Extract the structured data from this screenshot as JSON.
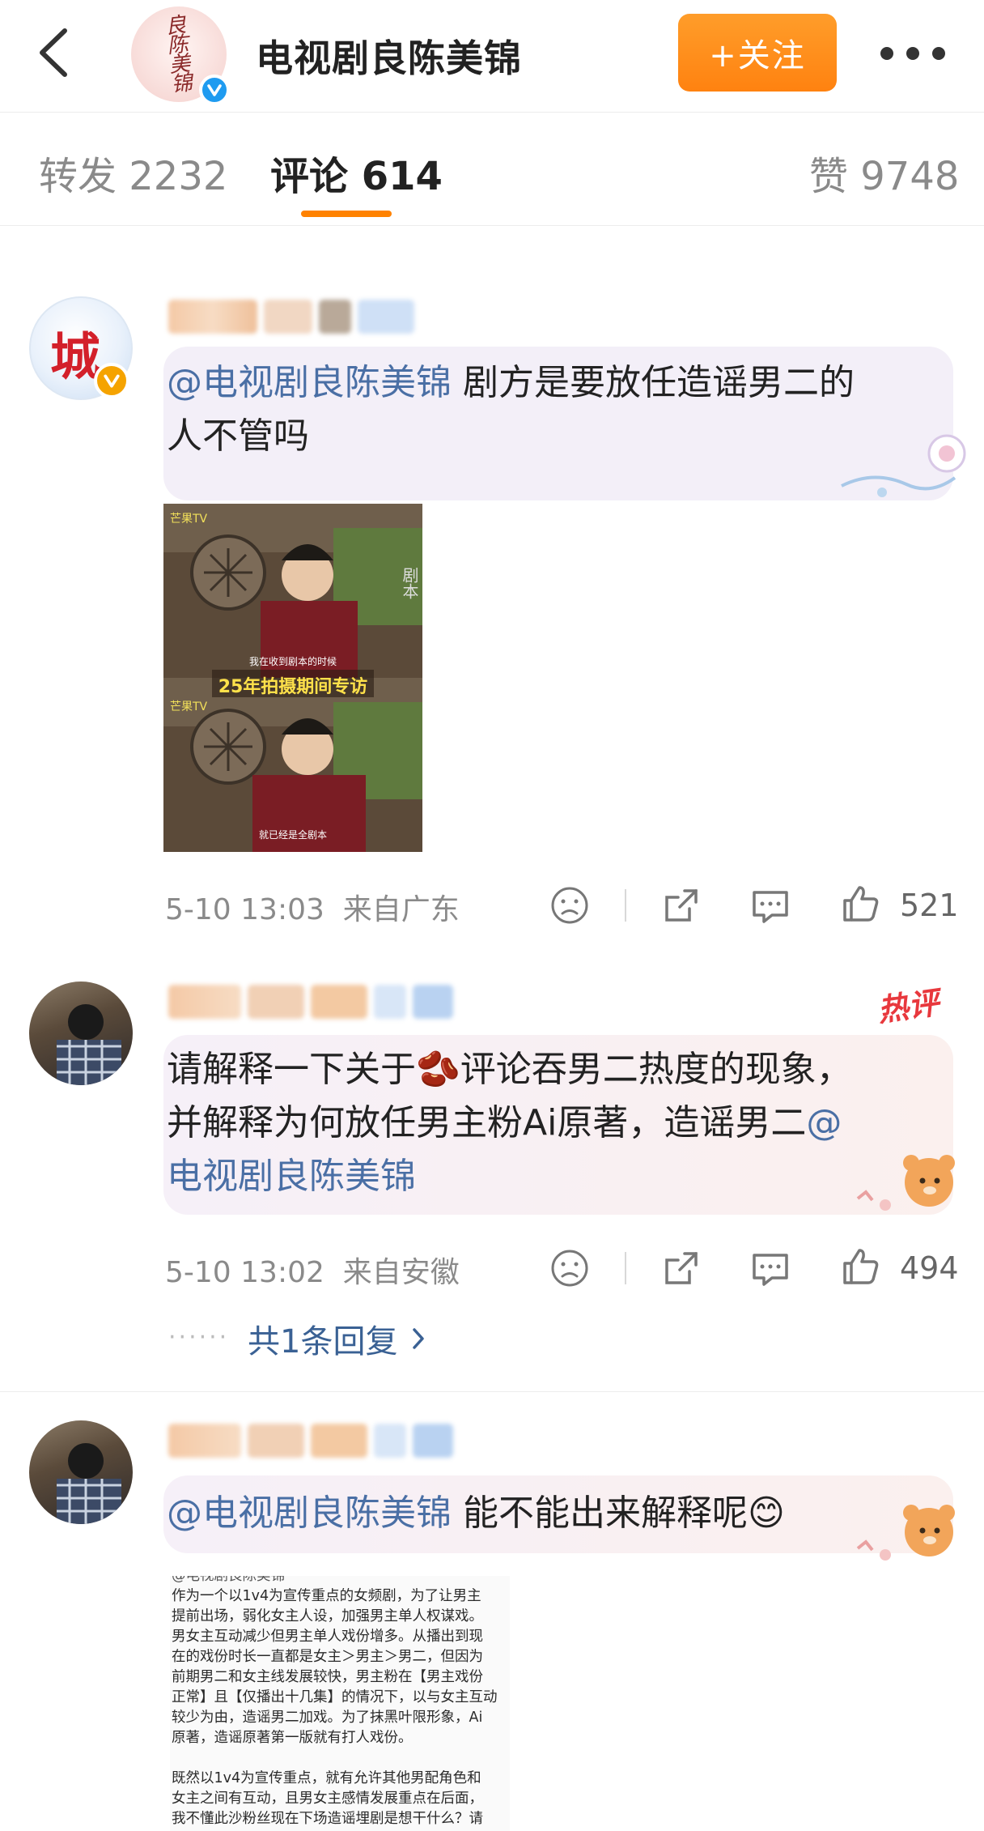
{
  "header": {
    "account_name": "电视剧良陈美锦",
    "avatar_glyphs": "良陈美锦",
    "follow_label": "+关注"
  },
  "tabs": [
    {
      "label": "转发 2232",
      "active": false
    },
    {
      "label": "评论 614",
      "active": true
    },
    {
      "label": "赞 9748",
      "active": false
    }
  ],
  "comments": [
    {
      "avatar_char": "城",
      "mention": "@电视剧良陈美锦",
      "text_line1": "剧方是要放任造谣男二的",
      "text_line2": "人不管吗",
      "video": {
        "watermark_top": "芒果TV",
        "caption_top": "我在收到剧本的时候",
        "banner": "25年拍摄期间专访",
        "side_text": "剧本",
        "watermark_bottom": "芒果TV",
        "caption_bottom": "就已经是全剧本"
      },
      "time": "5-10 13:03",
      "location": "来自广东",
      "likes": "521"
    },
    {
      "hot_tag": "热评",
      "text_line1": "请解释一下关于🫘评论吞男二热度的现象，",
      "text_line2_a": "并解释为何放任男主粉Ai原著，造谣男二",
      "text_line2_b": "@",
      "text_line3": "电视剧良陈美锦",
      "time": "5-10 13:02",
      "location": "来自安徽",
      "likes": "494",
      "replies_label": "共1条回复"
    },
    {
      "mention": "@电视剧良陈美锦",
      "text": "能不能出来解释呢😊",
      "doc_lines": [
        "@电视剧良陈美锦",
        "作为一个以1v4为宣传重点的女频剧，为了让男主",
        "提前出场，弱化女主人设，加强男主单人权谋戏。",
        "男女主互动减少但男主单人戏份增多。从播出到现",
        "在的戏份时长一直都是女主＞男主＞男二，但因为",
        "前期男二和女主线发展较快，男主粉在【男主戏份",
        "正常】且【仅播出十几集】的情况下，以与女主互动",
        "较少为由，造谣男二加戏。为了抹黑叶限形象，Ai",
        "原著，造谣原著第一版就有打人戏份。",
        "",
        "既然以1v4为宣传重点，就有允许其他男配角色和",
        "女主之间有互动，且男女主感情发展重点在后面，",
        "我不懂此沙粉丝现在下场造谣埋剧是想干什么？请"
      ]
    }
  ],
  "colors": {
    "accent": "#ff8200",
    "mention": "#4a6fa5",
    "hot": "#e8383d",
    "bubble": "#f3eff8"
  },
  "icons": [
    "back-icon",
    "more-icon",
    "dislike-icon",
    "share-icon",
    "comment-icon",
    "like-icon",
    "chevron-right-icon",
    "verified-icon"
  ]
}
